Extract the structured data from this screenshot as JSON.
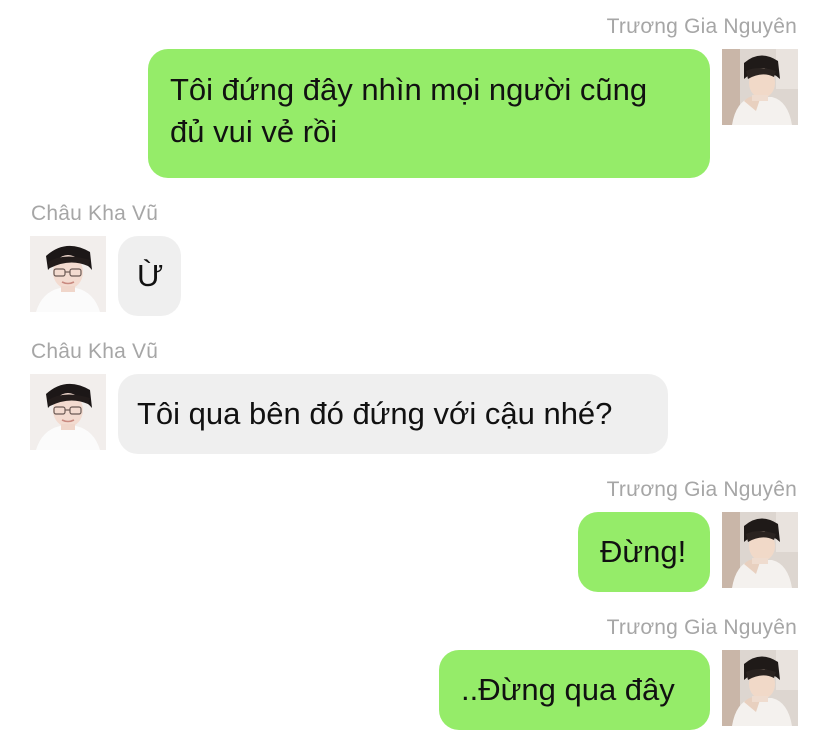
{
  "colors": {
    "outgoing_bubble": "#95ec69",
    "incoming_bubble": "#efefef",
    "sender_name": "#a6a6a6",
    "message_text": "#111111"
  },
  "messages": [
    {
      "direction": "outgoing",
      "sender": "Trương Gia Nguyên",
      "avatar_icon": "user-avatar-icon",
      "lines": [
        "Tôi đứng đây nhìn mọi người cũng",
        "đủ vui vẻ rồi"
      ]
    },
    {
      "direction": "incoming",
      "sender": "Châu Kha Vũ",
      "avatar_icon": "user-avatar-icon",
      "lines": [
        "Ừ"
      ]
    },
    {
      "direction": "incoming",
      "sender": "Châu Kha Vũ",
      "avatar_icon": "user-avatar-icon",
      "lines": [
        "Tôi qua bên đó đứng với cậu nhé?"
      ]
    },
    {
      "direction": "outgoing",
      "sender": "Trương Gia Nguyên",
      "avatar_icon": "user-avatar-icon",
      "lines": [
        "Đừng!"
      ]
    },
    {
      "direction": "outgoing",
      "sender": "Trương Gia Nguyên",
      "avatar_icon": "user-avatar-icon",
      "lines": [
        "..Đừng qua đây"
      ]
    }
  ]
}
